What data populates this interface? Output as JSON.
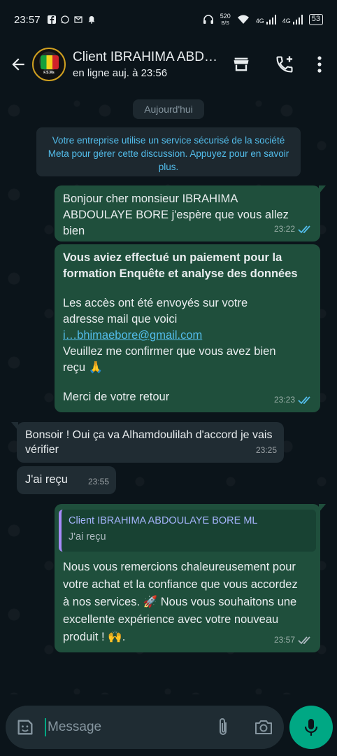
{
  "status_bar": {
    "time": "23:57",
    "net_speed_value": "520",
    "net_speed_unit": "B/S",
    "signal1": "4G",
    "signal2": "4G",
    "battery": "53"
  },
  "header": {
    "contact_name": "Client IBRAHIMA ABDOULAYE BORE ML",
    "contact_status": "en ligne auj. à 23:56",
    "avatar_text": "F.S.Ms"
  },
  "chat": {
    "date_chip": "Aujourd'hui",
    "system_notice": "Votre entreprise utilise un service sécurisé de la société Meta pour gérer cette discussion. Appuyez pour en savoir plus.",
    "messages": [
      {
        "direction": "out",
        "text": "Bonjour cher monsieur IBRAHIMA ABDOULAYE BORE j'espère que vous allez bien",
        "time": "23:22",
        "read": true
      },
      {
        "direction": "out",
        "bold_line": "Vous aviez effectué un paiement pour la formation Enquête et analyse des données",
        "line2": "Les accès ont été envoyés sur votre adresse mail que voici",
        "email": "i…bhimaebore@gmail.com",
        "line3": "Veuillez me confirmer que vous avez bien reçu 🙏",
        "line4": "Merci de votre retour",
        "time": "23:23",
        "read": true
      },
      {
        "direction": "in",
        "text": "Bonsoir ! Oui ça va Alhamdoulilah d'accord je vais vérifier",
        "time": "23:25"
      },
      {
        "direction": "in",
        "text": "J'ai reçu",
        "time": "23:55"
      },
      {
        "direction": "out",
        "quote_author": "Client IBRAHIMA ABDOULAYE BORE ML",
        "quote_text": "J'ai reçu",
        "text": "Nous vous remercions chaleureusement pour votre achat et la confiance que vous accordez à nos services. 🚀 Nous vous souhaitons une excellente expérience avec votre nouveau produit ! 🙌.",
        "time": "23:57",
        "read": false
      }
    ]
  },
  "composer": {
    "placeholder": "Message"
  },
  "colors": {
    "background": "#0b141a",
    "outgoing_bubble": "#1f4f3c",
    "incoming_bubble": "#202c33",
    "accent_green": "#00a884",
    "link_blue": "#53bdeb",
    "read_ticks": "#53bdeb"
  },
  "icons": {
    "back": "arrow-left-icon",
    "shop": "storefront-icon",
    "add_call": "phone-plus-icon",
    "menu": "more-vertical-icon",
    "emoji": "sticker-icon",
    "attach": "paperclip-icon",
    "camera": "camera-icon",
    "mic": "microphone-icon"
  }
}
